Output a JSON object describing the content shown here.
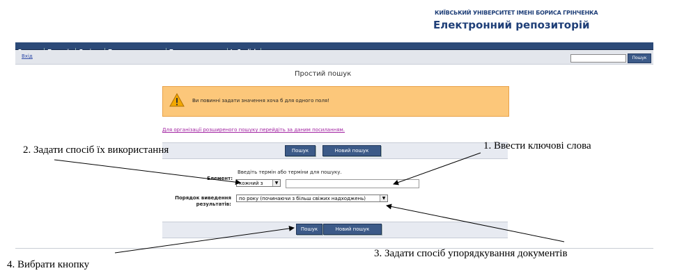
{
  "header": {
    "university": "КИЇВСЬКИЙ УНІВЕРСИТЕТ ІМЕНІ БОРИСА ГРІНЧЕНКА",
    "repository": "Електронний репозиторій"
  },
  "nav": {
    "items": [
      {
        "label": "Головна"
      },
      {
        "label": "Про сайт"
      },
      {
        "label": "Довідка"
      },
      {
        "label": "Перегляд по рокам"
      },
      {
        "label": "Перегляд по темам"
      },
      {
        "label": "In English"
      }
    ]
  },
  "toolbar": {
    "login": "Вхід",
    "search_button": "Пошук",
    "search_value": ""
  },
  "page": {
    "title": "Простий пошук",
    "warning": "Ви повинні задати значення хоча б для одного поля!",
    "advanced_link": "Для організації розширеного пошуку перейдіть за даним посиланням."
  },
  "form": {
    "search_button": "Пошук",
    "new_search_button": "Новий пошук",
    "element_label": "Елемент:",
    "hint": "Введіть термін або терміни для пошуку.",
    "mode_select": "кожний з",
    "term_value": "",
    "order_label": "Порядок виведення результатів:",
    "order_select": "по року (починаючи з більш свіжих надходжень)"
  },
  "annotations": {
    "a1": "1. Ввести ключові слова",
    "a2": "2. Задати спосіб їх використання",
    "a3": "3. Задати спосіб упорядкування документів",
    "a4": "4. Вибрати кнопку"
  },
  "colors": {
    "nav": "#2c4a78",
    "warning_bg": "#fcc77a",
    "link": "#a020a0"
  }
}
